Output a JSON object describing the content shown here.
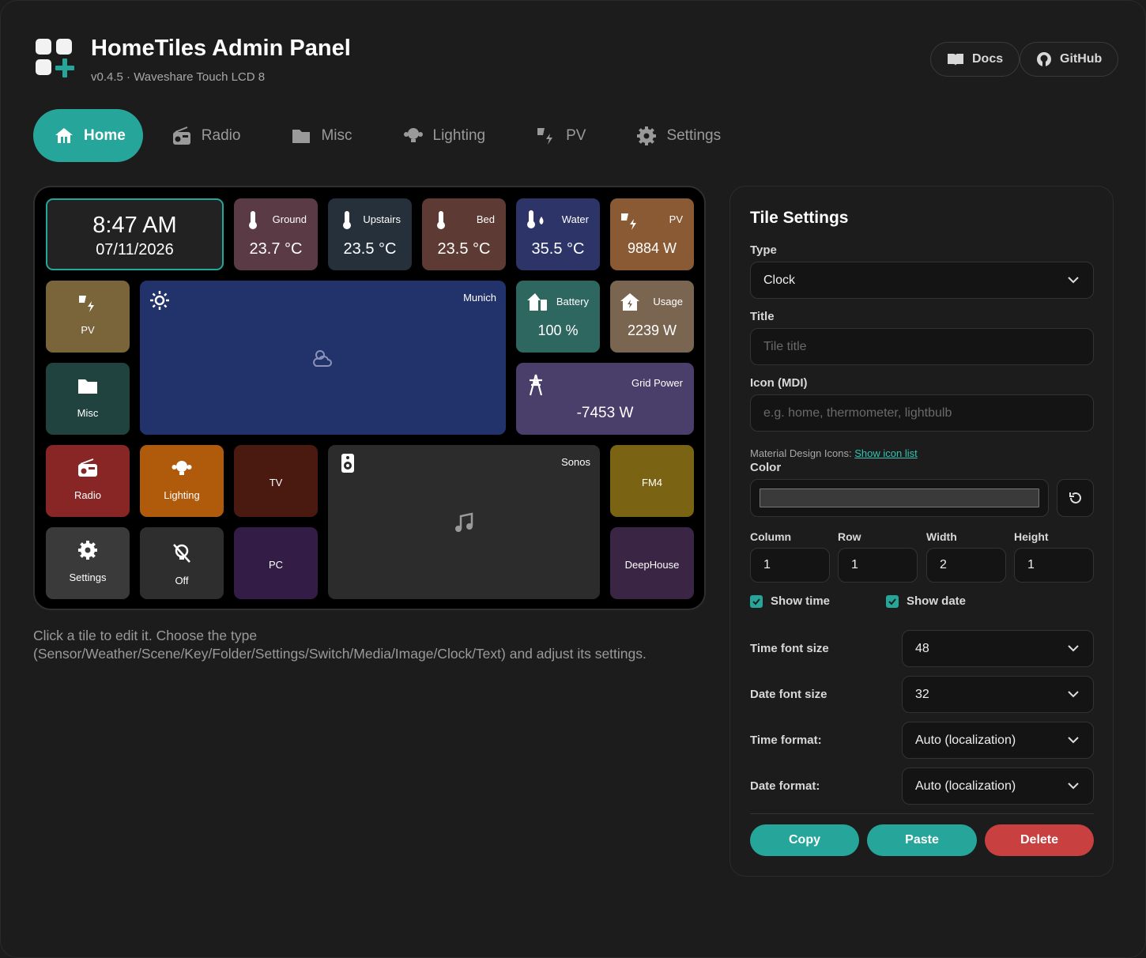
{
  "header": {
    "title": "HomeTiles Admin Panel",
    "subtitle": "v0.4.5 · Waveshare Touch LCD 8",
    "docs_label": "Docs",
    "github_label": "GitHub"
  },
  "tabs": [
    {
      "label": "Home",
      "icon": "home-icon",
      "active": true
    },
    {
      "label": "Radio",
      "icon": "radio-icon"
    },
    {
      "label": "Misc",
      "icon": "folder-icon"
    },
    {
      "label": "Lighting",
      "icon": "lightbulb-group-icon"
    },
    {
      "label": "PV",
      "icon": "solar-power-icon"
    },
    {
      "label": "Settings",
      "icon": "gear-icon"
    }
  ],
  "tiles": {
    "clock": {
      "time": "8:47 AM",
      "date": "07/11/2026"
    },
    "ground": {
      "title": "Ground",
      "value": "23.7 °C",
      "color": "#5a3a45"
    },
    "upstairs": {
      "title": "Upstairs",
      "value": "23.5 °C",
      "color": "#26303a"
    },
    "bed": {
      "title": "Bed",
      "value": "23.5 °C",
      "color": "#5e3a34"
    },
    "water": {
      "title": "Water",
      "value": "35.5 °C",
      "color": "#2d3568"
    },
    "pv_top": {
      "title": "PV",
      "value": "9884 W",
      "color": "#8a5a34"
    },
    "pv_key": {
      "title": "PV",
      "color": "#7a643a"
    },
    "weather": {
      "title": "Munich",
      "color": "#22326a"
    },
    "battery": {
      "title": "Battery",
      "value": "100 %",
      "color": "#2e6660"
    },
    "usage": {
      "title": "Usage",
      "value": "2239 W",
      "color": "#7a6650"
    },
    "misc": {
      "title": "Misc",
      "color": "#21433f"
    },
    "grid": {
      "title": "Grid Power",
      "value": "-7453 W",
      "color": "#4a3e6a"
    },
    "radio": {
      "title": "Radio",
      "color": "#882626"
    },
    "lighting": {
      "title": "Lighting",
      "color": "#b05a0c"
    },
    "tv": {
      "title": "TV",
      "color": "#4a1a10"
    },
    "sonos": {
      "title": "Sonos",
      "color": "#2c2c2c"
    },
    "fm4": {
      "title": "FM4",
      "color": "#7a6414"
    },
    "settings": {
      "title": "Settings",
      "color": "#3a3a3a"
    },
    "off": {
      "title": "Off",
      "color": "#2e2e2e"
    },
    "pc": {
      "title": "PC",
      "color": "#331c45"
    },
    "deephouse": {
      "title": "DeepHouse",
      "color": "#3a2545"
    }
  },
  "hint": "Click a tile to edit it. Choose the type (Sensor/Weather/Scene/Key/Folder/Settings/Switch/Media/Image/Clock/Text) and adjust its settings.",
  "panel": {
    "heading": "Tile Settings",
    "type_label": "Type",
    "type_value": "Clock",
    "title_label": "Title",
    "title_placeholder": "Tile title",
    "icon_label": "Icon (MDI)",
    "icon_placeholder": "e.g. home, thermometer, lightbulb",
    "mdi_note": "Material Design Icons:",
    "mdi_link": "Show icon list",
    "color_label": "Color",
    "column_label": "Column",
    "row_label": "Row",
    "width_label": "Width",
    "height_label": "Height",
    "column_value": "1",
    "row_value": "1",
    "width_value": "2",
    "height_value": "1",
    "show_time": "Show time",
    "show_date": "Show date",
    "time_font_label": "Time font size",
    "time_font_value": "48",
    "date_font_label": "Date font size",
    "date_font_value": "32",
    "time_format_label": "Time format:",
    "time_format_value": "Auto (localization)",
    "date_format_label": "Date format:",
    "date_format_value": "Auto (localization)",
    "copy_label": "Copy",
    "paste_label": "Paste",
    "delete_label": "Delete"
  },
  "colors": {
    "accent": "#26a69a",
    "danger": "#c94040"
  }
}
